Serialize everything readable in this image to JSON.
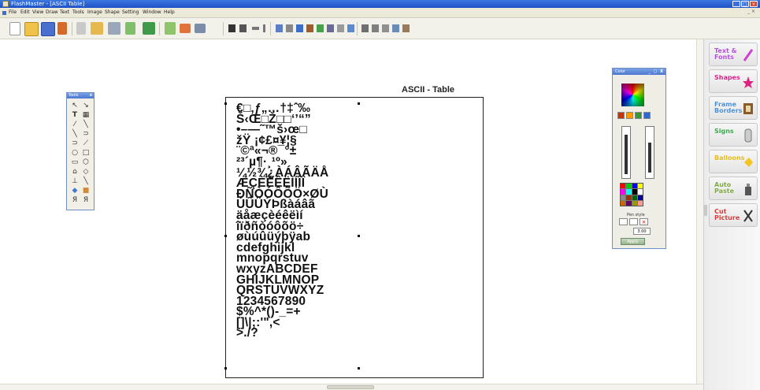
{
  "window": {
    "title": "FlashMaster - [ASCII Table]",
    "controls": [
      "_",
      "□",
      "×"
    ]
  },
  "menu": {
    "items": [
      "File",
      "Edit",
      "View",
      "Draw",
      "Text",
      "Tools",
      "Image",
      "Shape",
      "Setting",
      "Window",
      "Help"
    ],
    "mdi_controls": "_ ×"
  },
  "toolbar": {
    "icons": [
      "new-icon",
      "open-icon",
      "save-icon",
      "undo-arrow-icon",
      "cut-icon",
      "paste-icon",
      "print-icon",
      "export-icon",
      "book-icon",
      "image-icon",
      "undo-icon",
      "redo-icon",
      "pointer-icon",
      "subselect-icon",
      "flip-h-icon",
      "flip-v-icon",
      "align-icon",
      "move-icon",
      "pen-icon",
      "brush-icon",
      "fill-icon",
      "transform-icon",
      "zoom-icon",
      "group-icon",
      "ungroup-icon",
      "order-icon",
      "layer-icon"
    ]
  },
  "tools_panel": {
    "title": "Tools",
    "close": "x",
    "tools": [
      "arrow",
      "subselect",
      "text",
      "image",
      "line",
      "pencil",
      "curve",
      "freehand",
      "rectangle",
      "rounded-rect",
      "polygon",
      "star",
      "fill",
      "eyedropper",
      "paint",
      "stamp",
      "eraser",
      "hand"
    ]
  },
  "document": {
    "table_title": "ASCII - Table",
    "ascii_lines": [
      "€□‚ƒ„…†‡ˆ‰",
      "Š‹Œ□Ž□□‘’“”",
      "•–—˜™š›œ□",
      "žŸ ¡¢£¤¥¦§",
      "¨©ª«¬­®¯°±",
      "²³´µ¶·¸¹º»",
      "¼½¾¿ÀÁÂÃÄÅ",
      "ÆÇÈÉÊËÌÍÎÏ",
      "ÐÑÒÓÔÕÖ×ØÙ",
      "ÚÛÜÝÞßàáâã",
      "äåæçèéêëìí",
      "îïðñòóôõö÷",
      "øùúûüýþÿab",
      "cdefghijkl",
      "mnopqrstuv",
      "wxyzABCDEF",
      "GHIJKLMNOP",
      "QRSTUVWXYZ",
      "1234567890",
      "$%^*()-_=+",
      "[]\\|;:'\",<",
      ">./?"
    ]
  },
  "color_panel": {
    "title": "Color",
    "controls": "_ □ X",
    "pen_style_label": "Pen style",
    "pen_width": "3.00",
    "apply_label": "Apply",
    "swatches": [
      "#cc3300",
      "#ff9900",
      "#339933",
      "#3366cc"
    ],
    "palette": [
      "#ff0000",
      "#00cc00",
      "#0000ff",
      "#ffff00",
      "#ff00ff",
      "#00ffff",
      "#000000",
      "#ffffff",
      "#888888",
      "#993300",
      "#006600",
      "#000099",
      "#cc6600",
      "#660066",
      "#999900",
      "#ff9999"
    ]
  },
  "sidebar": {
    "items": [
      {
        "label": "Text & Fonts",
        "color": "#b44fd9",
        "icon": "pencil-icon"
      },
      {
        "label": "Shapes",
        "color": "#d6258a",
        "icon": "star-icon"
      },
      {
        "label": "Frame Borders",
        "color": "#4a8fd6",
        "icon": "frame-icon"
      },
      {
        "label": "Signs",
        "color": "#3aa64a",
        "icon": "phone-icon"
      },
      {
        "label": "Balloons",
        "color": "#e6b81c",
        "icon": "balloon-icon"
      },
      {
        "label": "Auto Paste",
        "color": "#7fa846",
        "icon": "glue-icon"
      },
      {
        "label": "Cut Picture",
        "color": "#d63a3a",
        "icon": "scissors-icon"
      }
    ]
  }
}
